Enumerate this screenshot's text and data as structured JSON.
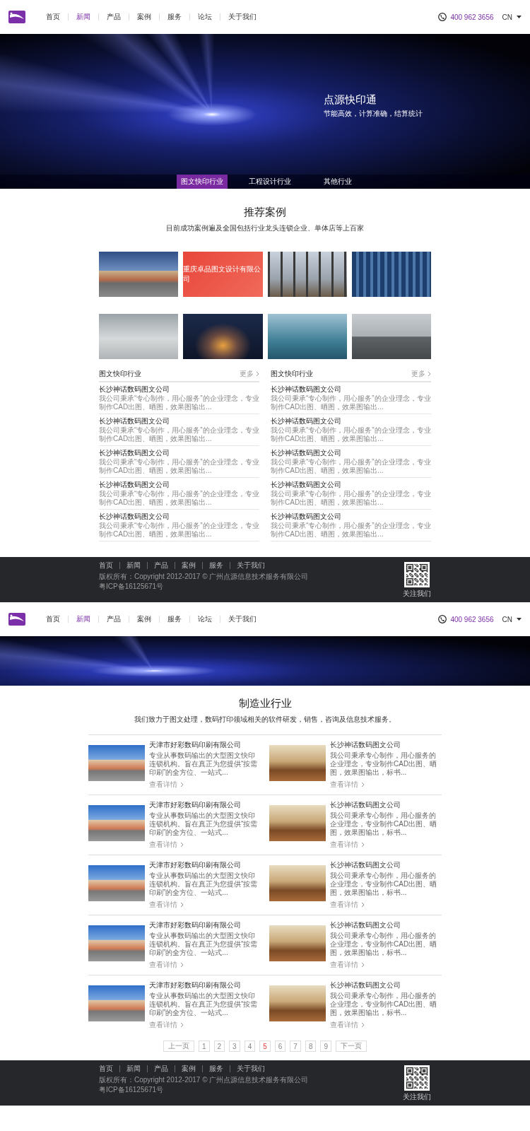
{
  "page_1": {
    "header": {
      "nav": [
        {
          "label": "首页",
          "selected": false
        },
        {
          "label": "新闻",
          "selected": true
        },
        {
          "label": "产品",
          "selected": false
        },
        {
          "label": "案例",
          "selected": false
        },
        {
          "label": "服务",
          "selected": false
        },
        {
          "label": "论坛",
          "selected": false
        },
        {
          "label": "关于我们",
          "selected": false
        }
      ],
      "phone": "400 962 3656",
      "language": "CN"
    },
    "hero": {
      "title": "点源快印通",
      "subtitle": "节能高效，计算准确，结算统计",
      "tabs": [
        {
          "label": "图文快印行业",
          "selected": true
        },
        {
          "label": "工程设计行业",
          "selected": false
        },
        {
          "label": "其他行业",
          "selected": false
        }
      ]
    },
    "cases": {
      "title": "推荐案例",
      "subtitle": "目前成功案例遍及全国包括行业龙头连锁企业、单体店等上百家",
      "tiles": [
        {
          "kind": "photo"
        },
        {
          "kind": "caption",
          "caption": "重庆卓品图文设计有限公司"
        },
        {
          "kind": "photo"
        },
        {
          "kind": "photo"
        },
        {
          "kind": "photo"
        },
        {
          "kind": "photo"
        },
        {
          "kind": "photo"
        },
        {
          "kind": "photo"
        }
      ]
    },
    "news_columns": [
      {
        "title": "图文快印行业",
        "more": "更多",
        "items": [
          {
            "title": "长沙神话数码图文公司",
            "summary": "我公司秉承“专心制作，用心服务”的企业理念，专业制作CAD出图、晒图，效果图输出..."
          },
          {
            "title": "长沙神话数码图文公司",
            "summary": "我公司秉承“专心制作，用心服务”的企业理念，专业制作CAD出图、晒图，效果图输出..."
          },
          {
            "title": "长沙神话数码图文公司",
            "summary": "我公司秉承“专心制作，用心服务”的企业理念，专业制作CAD出图、晒图，效果图输出..."
          },
          {
            "title": "长沙神话数码图文公司",
            "summary": "我公司秉承“专心制作，用心服务”的企业理念，专业制作CAD出图、晒图，效果图输出..."
          },
          {
            "title": "长沙神话数码图文公司",
            "summary": "我公司秉承“专心制作，用心服务”的企业理念，专业制作CAD出图、晒图，效果图输出..."
          }
        ]
      },
      {
        "title": "图文快印行业",
        "more": "更多",
        "items": [
          {
            "title": "长沙神话数码图文公司",
            "summary": "我公司秉承“专心制作，用心服务”的企业理念，专业制作CAD出图、晒图，效果图输出..."
          },
          {
            "title": "长沙神话数码图文公司",
            "summary": "我公司秉承“专心制作，用心服务”的企业理念，专业制作CAD出图、晒图，效果图输出..."
          },
          {
            "title": "长沙神话数码图文公司",
            "summary": "我公司秉承“专心制作，用心服务”的企业理念，专业制作CAD出图、晒图，效果图输出..."
          },
          {
            "title": "长沙神话数码图文公司",
            "summary": "我公司秉承“专心制作，用心服务”的企业理念，专业制作CAD出图、晒图，效果图输出..."
          },
          {
            "title": "长沙神话数码图文公司",
            "summary": "我公司秉承“专心制作，用心服务”的企业理念，专业制作CAD出图、晒图，效果图输出..."
          }
        ]
      }
    ],
    "footer": {
      "links": [
        "首页",
        "新闻",
        "产品",
        "案例",
        "服务",
        "关于我们"
      ],
      "copyright": "版权所有：Copyright 2012-2017 © 广州点源信息技术服务有限公司",
      "icp": "粤ICP备16125671号",
      "qr_caption": "关注我们"
    }
  },
  "page_2": {
    "header": {
      "nav": [
        {
          "label": "首页",
          "selected": false
        },
        {
          "label": "新闻",
          "selected": true
        },
        {
          "label": "产品",
          "selected": false
        },
        {
          "label": "案例",
          "selected": false
        },
        {
          "label": "服务",
          "selected": false
        },
        {
          "label": "论坛",
          "selected": false
        },
        {
          "label": "关于我们",
          "selected": false
        }
      ],
      "phone": "400 962 3656",
      "language": "CN"
    },
    "section": {
      "title": "制造业行业",
      "subtitle": "我们致力于图文处理，数码打印领域相关的软件研发，销售，咨询及信息技术服务。",
      "rows": [
        {
          "items": [
            {
              "title": "天津市好彩数码印刷有限公司",
              "summary": "专业从事数码输出的大型图文快印连锁机构。旨在真正为您提供“按需印刷”的全方位、一站式...",
              "link": "查看详情"
            },
            {
              "title": "长沙神话数码图文公司",
              "summary": "我公司秉承专心制作，用心服务的企业理念，专业制作CAD出图、晒图，效果图输出，标书...",
              "link": "查看详情"
            }
          ]
        },
        {
          "items": [
            {
              "title": "天津市好彩数码印刷有限公司",
              "summary": "专业从事数码输出的大型图文快印连锁机构。旨在真正为您提供“按需印刷”的全方位、一站式...",
              "link": "查看详情"
            },
            {
              "title": "长沙神话数码图文公司",
              "summary": "我公司秉承专心制作，用心服务的企业理念，专业制作CAD出图、晒图，效果图输出，标书...",
              "link": "查看详情"
            }
          ]
        },
        {
          "items": [
            {
              "title": "天津市好彩数码印刷有限公司",
              "summary": "专业从事数码输出的大型图文快印连锁机构。旨在真正为您提供“按需印刷”的全方位、一站式...",
              "link": "查看详情"
            },
            {
              "title": "长沙神话数码图文公司",
              "summary": "我公司秉承专心制作，用心服务的企业理念，专业制作CAD出图、晒图，效果图输出，标书...",
              "link": "查看详情"
            }
          ]
        },
        {
          "items": [
            {
              "title": "天津市好彩数码印刷有限公司",
              "summary": "专业从事数码输出的大型图文快印连锁机构。旨在真正为您提供“按需印刷”的全方位、一站式...",
              "link": "查看详情"
            },
            {
              "title": "长沙神话数码图文公司",
              "summary": "我公司秉承专心制作，用心服务的企业理念，专业制作CAD出图、晒图，效果图输出，标书...",
              "link": "查看详情"
            }
          ]
        },
        {
          "items": [
            {
              "title": "天津市好彩数码印刷有限公司",
              "summary": "专业从事数码输出的大型图文快印连锁机构。旨在真正为您提供“按需印刷”的全方位、一站式...",
              "link": "查看详情"
            },
            {
              "title": "长沙神话数码图文公司",
              "summary": "我公司秉承专心制作，用心服务的企业理念，专业制作CAD出图、晒图，效果图输出，标书...",
              "link": "查看详情"
            }
          ]
        }
      ]
    },
    "pagination": {
      "prev": "上一页",
      "pages": [
        {
          "label": "1",
          "selected": false
        },
        {
          "label": "2",
          "selected": false
        },
        {
          "label": "3",
          "selected": false
        },
        {
          "label": "4",
          "selected": false
        },
        {
          "label": "5",
          "selected": true
        },
        {
          "label": "6",
          "selected": false
        },
        {
          "label": "7",
          "selected": false
        },
        {
          "label": "8",
          "selected": false
        },
        {
          "label": "9",
          "selected": false
        }
      ],
      "next": "下一页"
    },
    "footer": {
      "links": [
        "首页",
        "新闻",
        "产品",
        "案例",
        "服务",
        "关于我们"
      ],
      "copyright": "版权所有：Copyright 2012-2017 © 广州点源信息技术服务有限公司",
      "icp": "粤ICP备16125671号",
      "qr_caption": "关注我们"
    }
  }
}
